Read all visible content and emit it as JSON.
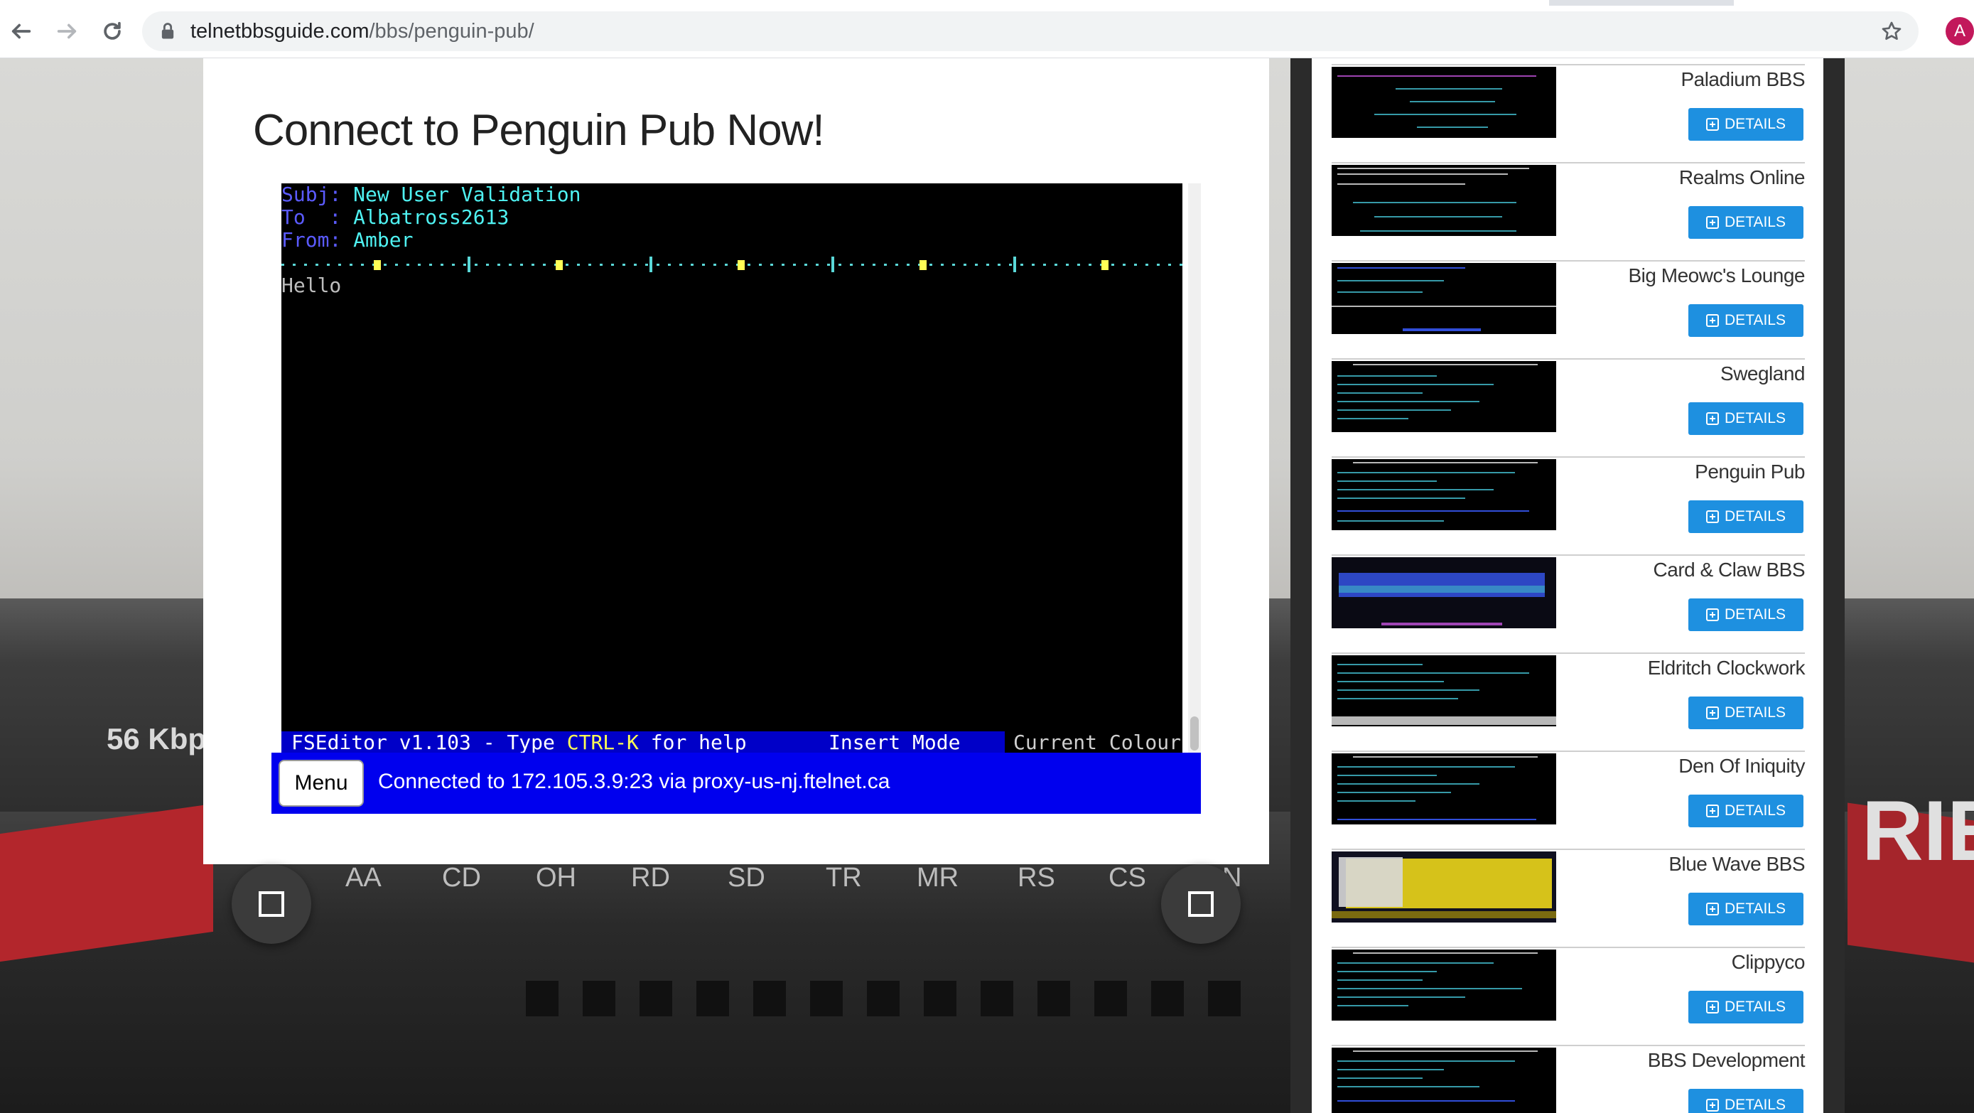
{
  "browser": {
    "url_domain": "telnetbbsguide.com",
    "url_path": "/bbs/penguin-pub/",
    "avatar_letter": "A",
    "icons": [
      "back-arrow-icon",
      "forward-arrow-icon",
      "reload-icon",
      "lock-icon",
      "star-icon"
    ]
  },
  "background": {
    "modem_speed": "56 Kbp",
    "brand_fragment": "RIER",
    "leds": [
      "AA",
      "CD",
      "OH",
      "RD",
      "SD",
      "TR",
      "MR",
      "RS",
      "CS",
      "N"
    ]
  },
  "main": {
    "title": "Connect to Penguin Pub Now!",
    "terminal": {
      "subj_label": "Subj",
      "subj_value": "New User Validation",
      "to_label": "To",
      "to_value": "Albatross2613",
      "from_label": "From",
      "from_value": "Amber",
      "body": "Hello",
      "status_editor": "FSEditor v1.103 - Type ",
      "status_key": "CTRL-K",
      "status_help": " for help",
      "status_mode": "Insert Mode",
      "status_colour": "Current Colour"
    },
    "menu_label": "Menu",
    "connection_status": "Connected to 172.105.3.9:23 via proxy-us-nj.ftelnet.ca"
  },
  "sidebar": {
    "details_label": "DETAILS",
    "items": [
      {
        "name": "Paladium BBS"
      },
      {
        "name": "Realms Online"
      },
      {
        "name": "Big Meowc's Lounge"
      },
      {
        "name": "Swegland"
      },
      {
        "name": "Penguin Pub"
      },
      {
        "name": "Card & Claw BBS"
      },
      {
        "name": "Eldritch Clockwork"
      },
      {
        "name": "Den Of Iniquity"
      },
      {
        "name": "Blue Wave BBS"
      },
      {
        "name": "Clippyco"
      },
      {
        "name": "BBS Development"
      }
    ]
  },
  "colors": {
    "details_button": "#1e90e0",
    "connection_bar": "#0000ee",
    "terminal_status": "#0000c8"
  }
}
